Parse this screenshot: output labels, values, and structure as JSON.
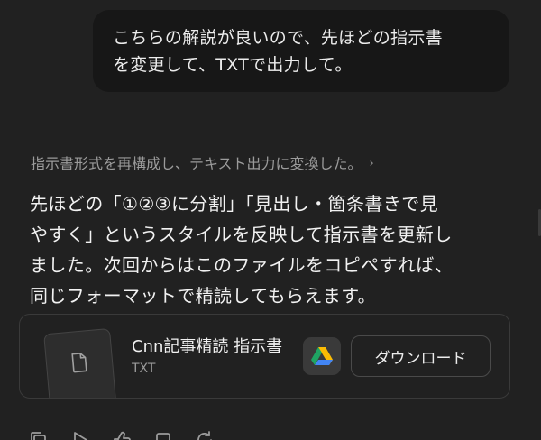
{
  "user_message": {
    "lines": [
      "こちらの解説が良いので、先ほどの指示書",
      "を変更して、TXTで出力して。"
    ]
  },
  "thought_summary": {
    "text": "指示書形式を再構成し、テキスト出力に変換した。",
    "chevron": "›"
  },
  "assistant_message": {
    "lines": [
      "先ほどの「①②③に分割」「見出し・箇条書きで見",
      "やすく」というスタイルを反映して指示書を更新し",
      "ました。次回からはこのファイルをコピペすれば、",
      "同じフォーマットで精読してもらえます。"
    ]
  },
  "file_card": {
    "title": "Cnn記事精読 指示書",
    "type": "TXT",
    "drive_icon": "google-drive-icon",
    "download_label": "ダウンロード"
  },
  "actions": {
    "icons": [
      "copy-icon",
      "read-aloud-icon",
      "thumbs-up-icon",
      "share-icon",
      "regenerate-icon"
    ]
  },
  "colors": {
    "background": "#212121",
    "user_bubble": "#171717",
    "text_primary": "#ececec",
    "text_secondary": "#9b9b9b",
    "border": "#3a3a3a"
  }
}
